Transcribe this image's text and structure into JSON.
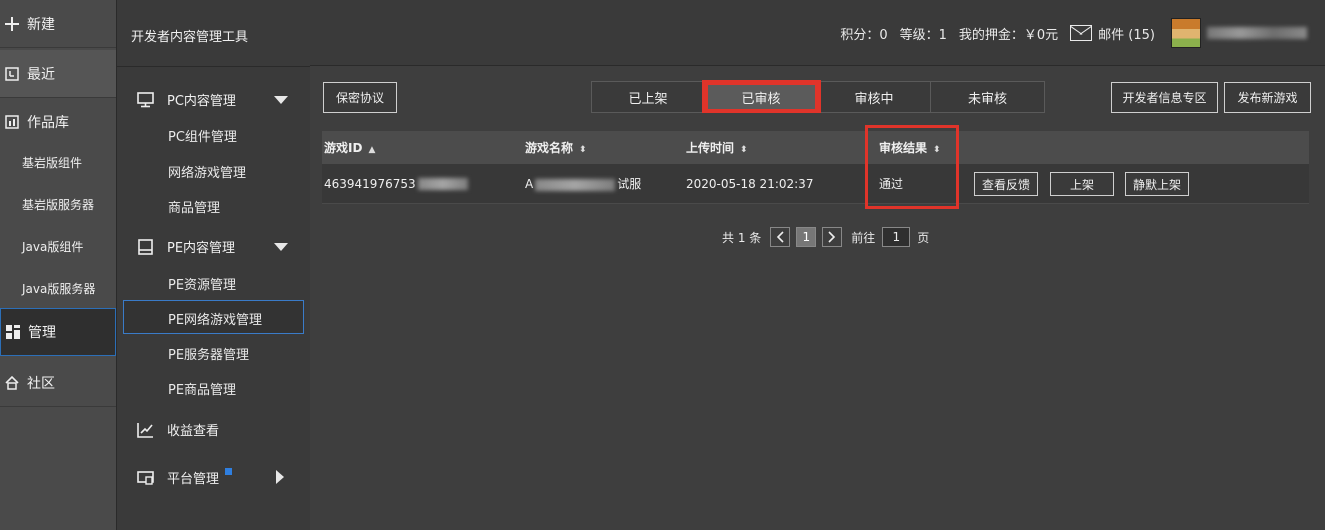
{
  "left_nav": {
    "new": "新建",
    "recent": "最近",
    "library": "作品库",
    "sub_items": [
      "基岩版组件",
      "基岩版服务器",
      "Java版组件",
      "Java版服务器"
    ],
    "manage": "管理",
    "community": "社区"
  },
  "sidebar": {
    "app_title": "开发者内容管理工具",
    "pc_group": "PC内容管理",
    "pc_items": [
      "PC组件管理",
      "网络游戏管理",
      "商品管理"
    ],
    "pe_group": "PE内容管理",
    "pe_items": [
      "PE资源管理",
      "PE网络游戏管理",
      "PE服务器管理",
      "PE商品管理"
    ],
    "revenue": "收益查看",
    "platform": "平台管理"
  },
  "header": {
    "points": "积分：0",
    "level": "等级：1",
    "deposit": "我的押金：￥0元",
    "mail": "邮件 (15)"
  },
  "toolbar": {
    "nda": "保密协议",
    "tabs": [
      "已上架",
      "已审核",
      "审核中",
      "未审核"
    ],
    "active_tab": "已审核",
    "dev_info": "开发者信息专区",
    "publish": "发布新游戏"
  },
  "table": {
    "headers": [
      "游戏ID",
      "游戏名称",
      "上传时间",
      "审核结果"
    ],
    "row": {
      "id": "463941976753",
      "name_prefix": "A",
      "name_suffix": "试服",
      "time": "2020-05-18 21:02:37",
      "result": "通过",
      "actions": [
        "查看反馈",
        "上架",
        "静默上架"
      ]
    }
  },
  "pager": {
    "total": "共 1 条",
    "page": "1",
    "goto": "前往",
    "goto_value": "1",
    "page_unit": "页"
  },
  "colors": {
    "highlight": "#e0342a",
    "selected_border": "#3a7bc8"
  }
}
